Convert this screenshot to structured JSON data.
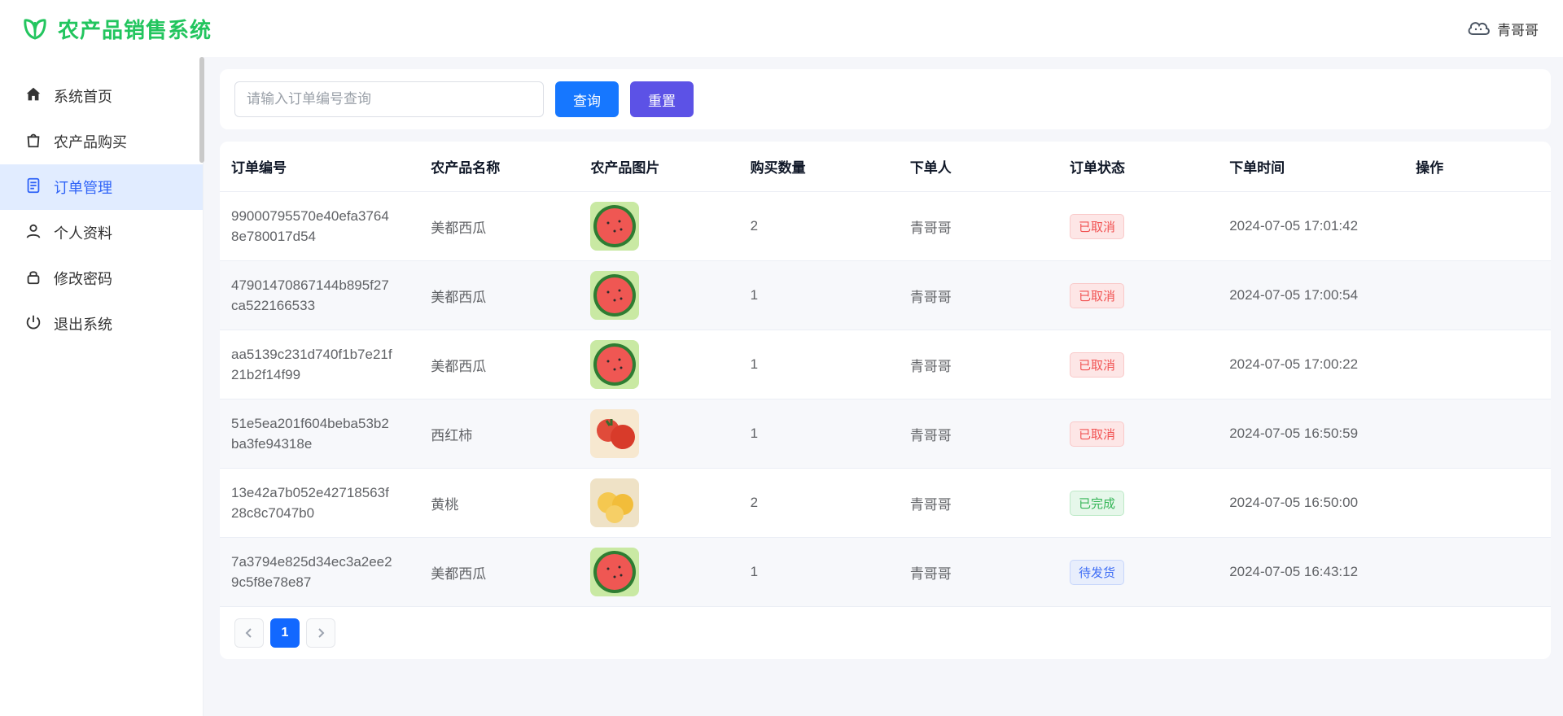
{
  "header": {
    "title": "农产品销售系统",
    "user": "青哥哥"
  },
  "sidebar": {
    "items": [
      {
        "label": "系统首页",
        "icon": "home"
      },
      {
        "label": "农产品购买",
        "icon": "bag"
      },
      {
        "label": "订单管理",
        "icon": "order",
        "active": true
      },
      {
        "label": "个人资料",
        "icon": "person"
      },
      {
        "label": "修改密码",
        "icon": "lock"
      },
      {
        "label": "退出系统",
        "icon": "power"
      }
    ]
  },
  "search": {
    "placeholder": "请输入订单编号查询",
    "query_btn": "查询",
    "reset_btn": "重置"
  },
  "table": {
    "headers": [
      "订单编号",
      "农产品名称",
      "农产品图片",
      "购买数量",
      "下单人",
      "订单状态",
      "下单时间",
      "操作"
    ],
    "rows": [
      {
        "id": "99000795570e40efa37648e780017d54",
        "name": "美都西瓜",
        "thumb": "watermelon",
        "qty": "2",
        "buyer": "青哥哥",
        "status": "已取消",
        "status_kind": "cancel",
        "time": "2024-07-05 17:01:42"
      },
      {
        "id": "47901470867144b895f27ca522166533",
        "name": "美都西瓜",
        "thumb": "watermelon",
        "qty": "1",
        "buyer": "青哥哥",
        "status": "已取消",
        "status_kind": "cancel",
        "time": "2024-07-05 17:00:54"
      },
      {
        "id": "aa5139c231d740f1b7e21f21b2f14f99",
        "name": "美都西瓜",
        "thumb": "watermelon",
        "qty": "1",
        "buyer": "青哥哥",
        "status": "已取消",
        "status_kind": "cancel",
        "time": "2024-07-05 17:00:22"
      },
      {
        "id": "51e5ea201f604beba53b2ba3fe94318e",
        "name": "西红柿",
        "thumb": "tomato",
        "qty": "1",
        "buyer": "青哥哥",
        "status": "已取消",
        "status_kind": "cancel",
        "time": "2024-07-05 16:50:59"
      },
      {
        "id": "13e42a7b052e42718563f28c8c7047b0",
        "name": "黄桃",
        "thumb": "peach",
        "qty": "2",
        "buyer": "青哥哥",
        "status": "已完成",
        "status_kind": "done",
        "time": "2024-07-05 16:50:00"
      },
      {
        "id": "7a3794e825d34ec3a2ee29c5f8e78e87",
        "name": "美都西瓜",
        "thumb": "watermelon",
        "qty": "1",
        "buyer": "青哥哥",
        "status": "待发货",
        "status_kind": "ship",
        "time": "2024-07-05 16:43:12"
      }
    ]
  },
  "pager": {
    "current": "1"
  }
}
